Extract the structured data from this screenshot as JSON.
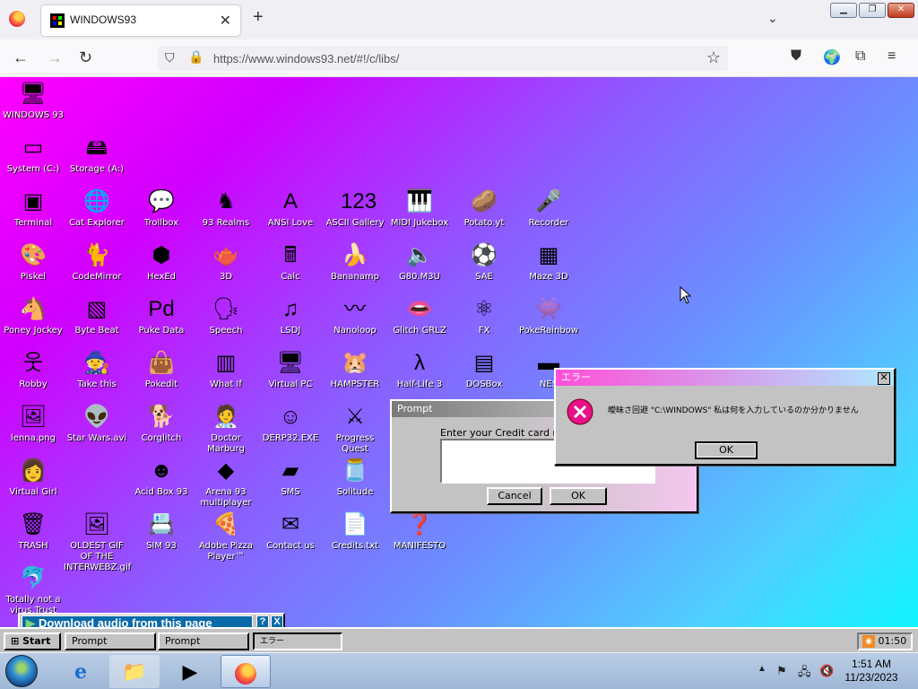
{
  "browser": {
    "tab_title": "WINDOWS93",
    "url": "https://www.windows93.net/#!/c/libs/"
  },
  "desktop_icons": [
    {
      "id": "windows93",
      "label": "WINDOWS 93",
      "icon": "computer-icon",
      "glyph": "🖥"
    },
    {
      "id": "system-c",
      "label": "System (C:)",
      "icon": "drive-icon",
      "glyph": "▭"
    },
    {
      "id": "storage-a",
      "label": "Storage (A:)",
      "icon": "floppy-drive-icon",
      "glyph": "🖴"
    },
    {
      "id": "terminal",
      "label": "Terminal",
      "icon": "terminal-icon",
      "glyph": "▣"
    },
    {
      "id": "cat-explorer",
      "label": "Cat Explorer",
      "icon": "cat-globe-icon",
      "glyph": "🌐"
    },
    {
      "id": "trollbox",
      "label": "Trollbox",
      "icon": "chat-icon",
      "glyph": "💬"
    },
    {
      "id": "93-realms",
      "label": "93 Realms",
      "icon": "knight-icon",
      "glyph": "♞"
    },
    {
      "id": "ansi-love",
      "label": "ANSI Love",
      "icon": "ansi-icon",
      "glyph": "A"
    },
    {
      "id": "ascii-gallery",
      "label": "ASCII Gallery",
      "icon": "ascii-icon",
      "glyph": "123"
    },
    {
      "id": "midi-jukebox",
      "label": "MIDI Jukebox",
      "icon": "piano-icon",
      "glyph": "🎹"
    },
    {
      "id": "potato",
      "label": "Potato.yt",
      "icon": "potato-icon",
      "glyph": "🥔"
    },
    {
      "id": "recorder",
      "label": "Recorder",
      "icon": "microphone-icon",
      "glyph": "🎤"
    },
    {
      "id": "piskel",
      "label": "Piskel",
      "icon": "palette-icon",
      "glyph": "🎨"
    },
    {
      "id": "codemirror",
      "label": "CodeMirror",
      "icon": "cat-icon",
      "glyph": "🐈"
    },
    {
      "id": "hexed",
      "label": "HexEd",
      "icon": "cube-icon",
      "glyph": "⬢"
    },
    {
      "id": "3d",
      "label": "3D",
      "icon": "teapot-icon",
      "glyph": "🫖"
    },
    {
      "id": "calc",
      "label": "Calc",
      "icon": "calculator-icon",
      "glyph": "🖩"
    },
    {
      "id": "bananamp",
      "label": "Bananamp",
      "icon": "banana-icon",
      "glyph": "🍌"
    },
    {
      "id": "g80m3u",
      "label": "G80.M3U",
      "icon": "speaker-file-icon",
      "glyph": "🔈"
    },
    {
      "id": "sae",
      "label": "SAE",
      "icon": "ball-icon",
      "glyph": "⚽"
    },
    {
      "id": "maze-3d",
      "label": "Maze 3D",
      "icon": "maze-icon",
      "glyph": "▦"
    },
    {
      "id": "poney-jockey",
      "label": "Poney Jockey",
      "icon": "pony-icon",
      "glyph": "🐴"
    },
    {
      "id": "byte-beat",
      "label": "Byte Beat",
      "icon": "bytebeat-icon",
      "glyph": "▧"
    },
    {
      "id": "puke-data",
      "label": "Puke Data",
      "icon": "pd-icon",
      "glyph": "Pd"
    },
    {
      "id": "speech",
      "label": "Speech",
      "icon": "face-icon",
      "glyph": "🗣"
    },
    {
      "id": "lsdj",
      "label": "LSDJ",
      "icon": "lsdj-icon",
      "glyph": "♫"
    },
    {
      "id": "nanoloop",
      "label": "Nanoloop",
      "icon": "wave-icon",
      "glyph": "〰"
    },
    {
      "id": "glitch-grlz",
      "label": "Glitch GRLZ",
      "icon": "lips-icon",
      "glyph": "👄"
    },
    {
      "id": "fx",
      "label": "FX",
      "icon": "atom-icon",
      "glyph": "⚛"
    },
    {
      "id": "pokerainbow",
      "label": "PokeRainbow",
      "icon": "pokemon-icon",
      "glyph": "👾"
    },
    {
      "id": "robby",
      "label": "Robby",
      "icon": "stickman-icon",
      "glyph": "웃"
    },
    {
      "id": "take-this",
      "label": "Take this",
      "icon": "oldman-icon",
      "glyph": "🧙"
    },
    {
      "id": "pokedit",
      "label": "Pokedit",
      "icon": "bag-icon",
      "glyph": "👜"
    },
    {
      "id": "what-if",
      "label": "What If",
      "icon": "chart-icon",
      "glyph": "▥"
    },
    {
      "id": "virtual-pc",
      "label": "Virtual PC",
      "icon": "virtual-pc-icon",
      "glyph": "🖥"
    },
    {
      "id": "hampster",
      "label": "HAMPSTER",
      "icon": "hamster-icon",
      "glyph": "🐹"
    },
    {
      "id": "half-life-3",
      "label": "Half-Life 3",
      "icon": "lambda-icon",
      "glyph": "λ"
    },
    {
      "id": "dosbox",
      "label": "DOSBox",
      "icon": "dosbox-icon",
      "glyph": "▤"
    },
    {
      "id": "nes",
      "label": "NES",
      "icon": "nes-icon",
      "glyph": "▬"
    },
    {
      "id": "lenna",
      "label": "lenna.png",
      "icon": "image-file-icon",
      "glyph": "🖼"
    },
    {
      "id": "star-wars",
      "label": "Star Wars.avi",
      "icon": "yoda-icon",
      "glyph": "👽"
    },
    {
      "id": "corglitch",
      "label": "Corglitch",
      "icon": "corgi-icon",
      "glyph": "🐕"
    },
    {
      "id": "doctor-marburg",
      "label": "Doctor Marburg",
      "icon": "doctor-icon",
      "glyph": "🧑‍⚕️"
    },
    {
      "id": "derp32",
      "label": "DERP32.EXE",
      "icon": "derp-icon",
      "glyph": "☺"
    },
    {
      "id": "progress-quest",
      "label": "Progress Quest",
      "icon": "swords-icon",
      "glyph": "⚔"
    },
    {
      "id": "virtual-girl",
      "label": "Virtual Girl",
      "icon": "girl-icon",
      "glyph": "👩"
    },
    {
      "id": "acid-box",
      "label": "Acid Box 93",
      "icon": "smiley-icon",
      "glyph": "☻"
    },
    {
      "id": "arena-93",
      "label": "Arena 93 multiplayer",
      "icon": "arena-cube-icon",
      "glyph": "◆"
    },
    {
      "id": "sms",
      "label": "SMS",
      "icon": "console-icon",
      "glyph": "▰"
    },
    {
      "id": "solitude",
      "label": "Solitude",
      "icon": "jar-icon",
      "glyph": "🫙"
    },
    {
      "id": "trash",
      "label": "TRASH",
      "icon": "trash-icon",
      "glyph": "🗑"
    },
    {
      "id": "oldest-gif",
      "label": "OLDEST GIF OF THE INTERWEBZ.gif",
      "icon": "gif-file-icon",
      "glyph": "🖼"
    },
    {
      "id": "sim93",
      "label": "SIM 93",
      "icon": "sim-icon",
      "glyph": "📇"
    },
    {
      "id": "adobe-pizza",
      "label": "Adobe Pizza Player™",
      "icon": "pizza-icon",
      "glyph": "🍕"
    },
    {
      "id": "contact-us",
      "label": "Contact us",
      "icon": "letter-icon",
      "glyph": "✉"
    },
    {
      "id": "credits",
      "label": "Credits.txt",
      "icon": "text-file-icon",
      "glyph": "📄"
    },
    {
      "id": "manifesto",
      "label": "MANIFESTO",
      "icon": "question-icon",
      "glyph": "❓"
    },
    {
      "id": "totally-not-virus",
      "label": "Totally not a virus.Trust",
      "icon": "dolphin-icon",
      "glyph": "🐬"
    }
  ],
  "prompt_dialog": {
    "title": "Prompt",
    "message": "Enter your Credit card numb",
    "input_value": "",
    "cancel_label": "Cancel",
    "ok_label": "OK"
  },
  "error_dialog": {
    "title": "エラー",
    "message": "曖昧さ回避 \"C:\\WINDOWS\" 私は何を入力しているのか分かりません",
    "ok_label": "OK"
  },
  "download_bar": {
    "label": "Download audio from this page",
    "help": "?",
    "close": "X"
  },
  "w93_taskbar": {
    "start_label": "Start",
    "tasks": [
      "Prompt",
      "Prompt",
      "エラー"
    ],
    "clock": "01:50"
  },
  "win7_taskbar": {
    "time": "1:51 AM",
    "date": "11/23/2023"
  },
  "colors": {
    "desktop_gradient_start": "#ff00ff",
    "desktop_gradient_end": "#10f5ff",
    "w93_face": "#c3c3c3",
    "error_icon": "#e8108a"
  }
}
